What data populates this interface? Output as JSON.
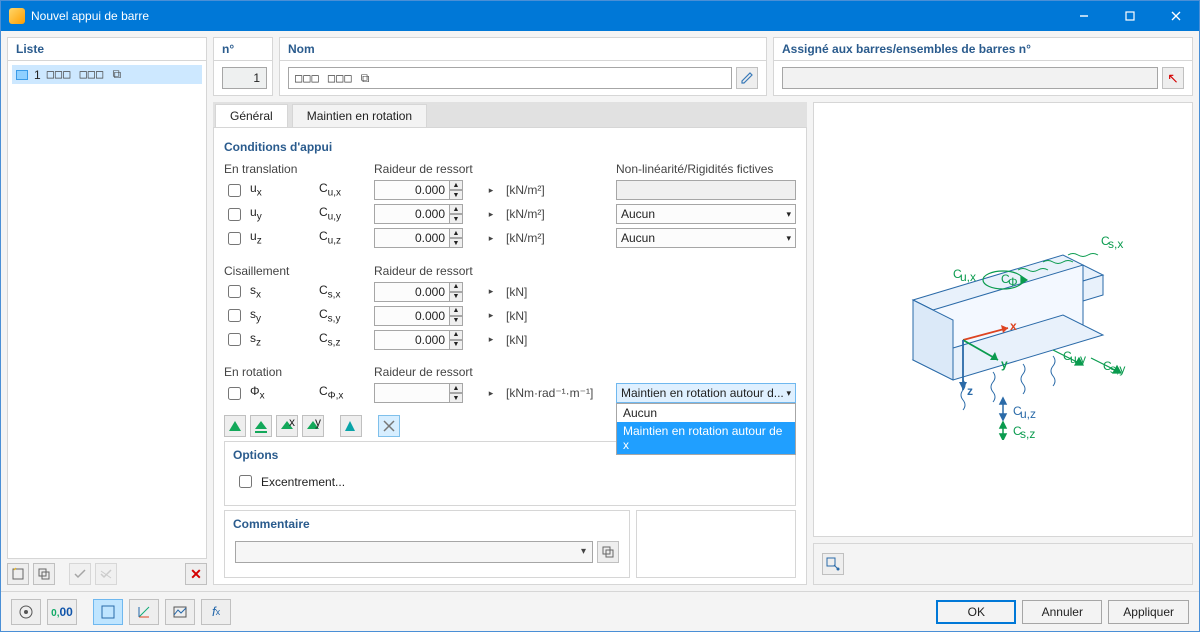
{
  "window": {
    "title": "Nouvel appui de barre"
  },
  "left_panel": {
    "header": "Liste",
    "item_number": "1",
    "item_glyph": "□□□ □□□ ⧉"
  },
  "top": {
    "num_header": "n°",
    "num_value": "1",
    "nom_header": "Nom",
    "nom_value": "□□□ □□□ ⧉",
    "assign_header": "Assigné aux barres/ensembles de barres n°"
  },
  "tabs": {
    "general": "Général",
    "rotation": "Maintien en rotation"
  },
  "sections": {
    "support": "Conditions d'appui",
    "options": "Options",
    "excentr": "Excentrement...",
    "comment": "Commentaire"
  },
  "headers": {
    "translation": "En translation",
    "shear": "Cisaillement",
    "rotation": "En rotation",
    "spring": "Raideur de ressort",
    "nonlin": "Non-linéarité/Rigidités fictives"
  },
  "rows": {
    "ux": {
      "label": "uₓ",
      "coef": "Cu,x",
      "value": "0.000",
      "unit": "[kN/m²]"
    },
    "uy": {
      "label": "uᵧ",
      "coef": "Cu,y",
      "value": "0.000",
      "unit": "[kN/m²]",
      "nl": "Aucun"
    },
    "uz": {
      "label": "u_z",
      "coef": "Cu,z",
      "value": "0.000",
      "unit": "[kN/m²]",
      "nl": "Aucun"
    },
    "sx": {
      "label": "sₓ",
      "coef": "Cs,x",
      "value": "0.000",
      "unit": "[kN]"
    },
    "sy": {
      "label": "sᵧ",
      "coef": "Cs,y",
      "value": "0.000",
      "unit": "[kN]"
    },
    "sz": {
      "label": "s_z",
      "coef": "Cs,z",
      "value": "0.000",
      "unit": "[kN]"
    },
    "phix": {
      "label": "Φₓ",
      "coef": "CΦ,x",
      "value": "",
      "unit": "[kNm·rad⁻¹·m⁻¹]",
      "nl": "Maintien en rotation autour d..."
    }
  },
  "dropdown": {
    "opt1": "Aucun",
    "opt2": "Maintien en rotation autour de x"
  },
  "footer": {
    "ok": "OK",
    "cancel": "Annuler",
    "apply": "Appliquer"
  }
}
